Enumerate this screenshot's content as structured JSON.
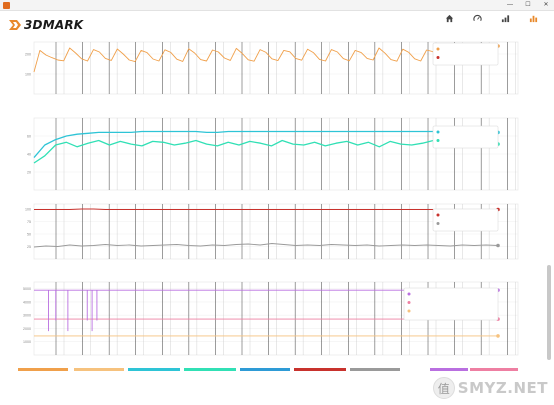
{
  "window": {
    "title": "",
    "minimize": "—",
    "maximize": "☐",
    "close": "✕"
  },
  "header": {
    "logo_text": "3DMARK",
    "nav": [
      {
        "label": "",
        "icon": "home-icon"
      },
      {
        "label": "",
        "icon": "gauge-icon"
      },
      {
        "label": "",
        "icon": "stress-icon"
      },
      {
        "label": "",
        "icon": "results-icon",
        "active": true
      }
    ]
  },
  "colors": {
    "orange": "#f0a04b",
    "cyan": "#2ec4d6",
    "teal": "#31e0b5",
    "red": "#c8322d",
    "gray": "#9a9a9a",
    "purple": "#b96fe0",
    "pink": "#ee7fa2",
    "peach": "#f6c27e",
    "accent": "#e8892b"
  },
  "chart_data": [
    {
      "type": "line",
      "title": "",
      "ylabel": "",
      "x_ticks": [
        "",
        "",
        "",
        "",
        "",
        "",
        "",
        "",
        ""
      ],
      "series": [
        {
          "name": "",
          "color": "#f0a04b",
          "values": [
            110,
            218,
            195,
            182,
            170,
            166,
            230,
            205,
            176,
            165,
            222,
            210,
            178,
            168,
            225,
            200,
            170,
            162,
            218,
            207,
            175,
            165,
            221,
            208,
            174,
            163,
            226,
            205,
            172,
            165,
            220,
            210,
            180,
            168,
            228,
            203,
            171,
            164,
            222,
            208,
            176,
            167,
            218,
            211,
            178,
            169,
            224,
            206,
            173,
            165,
            222,
            210,
            177,
            166,
            218,
            207,
            178,
            170,
            230,
            204,
            172,
            164,
            224,
            208,
            176,
            165,
            220,
            212,
            180,
            168,
            230,
            206,
            174,
            165,
            222,
            208,
            176,
            168,
            240
          ]
        }
      ],
      "tooltip": {
        "rows": [
          {
            "label": "",
            "value": "",
            "color": "#f0a04b"
          },
          {
            "label": "",
            "value": "",
            "color": "#c8322d"
          }
        ]
      }
    },
    {
      "type": "line",
      "title": "",
      "ylabel": "",
      "x_ticks": [
        "",
        "",
        "",
        "",
        "",
        "",
        "",
        "",
        ""
      ],
      "series": [
        {
          "name": "",
          "color": "#2ec4d6",
          "values": [
            36,
            50,
            56,
            60,
            62,
            63,
            64,
            64,
            64,
            64,
            65,
            65,
            65,
            65,
            65,
            65,
            64,
            64,
            65,
            65,
            65,
            65,
            65,
            65,
            65,
            65,
            65,
            65,
            65,
            65,
            65,
            65,
            65,
            65,
            65,
            65,
            65,
            65,
            65,
            65,
            64,
            64,
            64,
            64
          ]
        },
        {
          "name": "",
          "color": "#31e0b5",
          "values": [
            30,
            38,
            50,
            53,
            48,
            52,
            55,
            50,
            54,
            51,
            49,
            54,
            53,
            50,
            52,
            55,
            51,
            49,
            53,
            50,
            54,
            52,
            49,
            55,
            51,
            50,
            53,
            49,
            52,
            54,
            50,
            53,
            48,
            54,
            51,
            50,
            52,
            55,
            49,
            53,
            52,
            50,
            55,
            51
          ]
        }
      ],
      "tooltip": {
        "rows": [
          {
            "label": "",
            "value": "",
            "color": "#2ec4d6"
          },
          {
            "label": "",
            "value": "",
            "color": "#31e0b5"
          }
        ]
      }
    },
    {
      "type": "line",
      "title": "",
      "ylabel": "",
      "x_ticks": [
        "",
        "",
        "",
        "",
        "",
        "",
        "",
        "",
        ""
      ],
      "series": [
        {
          "name": "",
          "color": "#c8322d",
          "values": [
            99,
            99,
            99,
            99,
            100,
            100,
            99,
            99,
            99,
            99,
            99,
            99,
            99,
            99,
            99,
            99,
            99,
            99,
            99,
            99,
            99,
            99,
            99,
            99,
            99,
            99,
            99,
            99,
            99,
            99,
            99,
            99,
            99,
            99,
            99,
            99,
            99,
            99,
            99,
            99
          ]
        },
        {
          "name": "",
          "color": "#9a9a9a",
          "values": [
            24,
            26,
            25,
            28,
            26,
            27,
            29,
            27,
            28,
            26,
            27,
            28,
            29,
            27,
            26,
            28,
            27,
            29,
            30,
            28,
            31,
            29,
            27,
            28,
            27,
            29,
            28,
            27,
            28,
            26,
            27,
            28,
            27,
            28,
            27,
            26,
            28,
            27,
            28,
            27
          ]
        }
      ],
      "tooltip": {
        "rows": [
          {
            "label": "",
            "value": "",
            "color": "#c8322d"
          },
          {
            "label": "",
            "value": "",
            "color": "#9a9a9a"
          }
        ]
      }
    },
    {
      "type": "line",
      "title": "",
      "ylabel": "",
      "x_ticks": [
        "",
        "",
        "",
        "",
        "",
        "",
        "",
        "",
        ""
      ],
      "series": [
        {
          "name": "",
          "color": "#b96fe0",
          "values": [
            4884,
            4884,
            4884,
            4884,
            4884,
            4884,
            4884,
            4884,
            4884,
            4884,
            4884,
            4884,
            4884,
            4884,
            4884,
            4884,
            4884,
            4884,
            4884,
            4884
          ]
        },
        {
          "name": "",
          "color": "#ee7fa2",
          "values": [
            2706,
            2706,
            2706,
            2706,
            2706,
            2706,
            2706,
            2706,
            2706,
            2706,
            2706,
            2706,
            2706,
            2706,
            2706,
            2706,
            2706,
            2706,
            2706,
            2706
          ]
        },
        {
          "name": "",
          "color": "#f6c27e",
          "values": [
            1437,
            1437,
            1437,
            1437,
            1437,
            1437,
            1437,
            1437,
            1437,
            1437,
            1437,
            1437,
            1437,
            1437,
            1437,
            1437,
            1437,
            1437,
            1437,
            1437
          ]
        }
      ],
      "tooltip": {
        "rows": [
          {
            "label": "",
            "value": "",
            "color": "#b96fe0"
          },
          {
            "label": "",
            "value": "",
            "color": "#ee7fa2"
          },
          {
            "label": "",
            "value": "",
            "color": "#f6c27e"
          }
        ]
      }
    }
  ],
  "legend": [
    {
      "label": "",
      "color": "#f0a04b"
    },
    {
      "label": "",
      "color": "#f6c27e"
    },
    {
      "label": "",
      "color": "#2ec4d6"
    },
    {
      "label": "",
      "color": "#31e0b5"
    },
    {
      "label": "",
      "color": "#2e9bd6"
    },
    {
      "label": "",
      "color": "#c8322d"
    },
    {
      "label": "",
      "color": "#9a9a9a"
    },
    {
      "label": "",
      "color": "#ffffff"
    },
    {
      "label": "",
      "color": "#b96fe0"
    },
    {
      "label": "",
      "color": "#ee7fa2"
    }
  ],
  "watermark": {
    "glyph": "值",
    "text": "SMYZ.NET"
  }
}
